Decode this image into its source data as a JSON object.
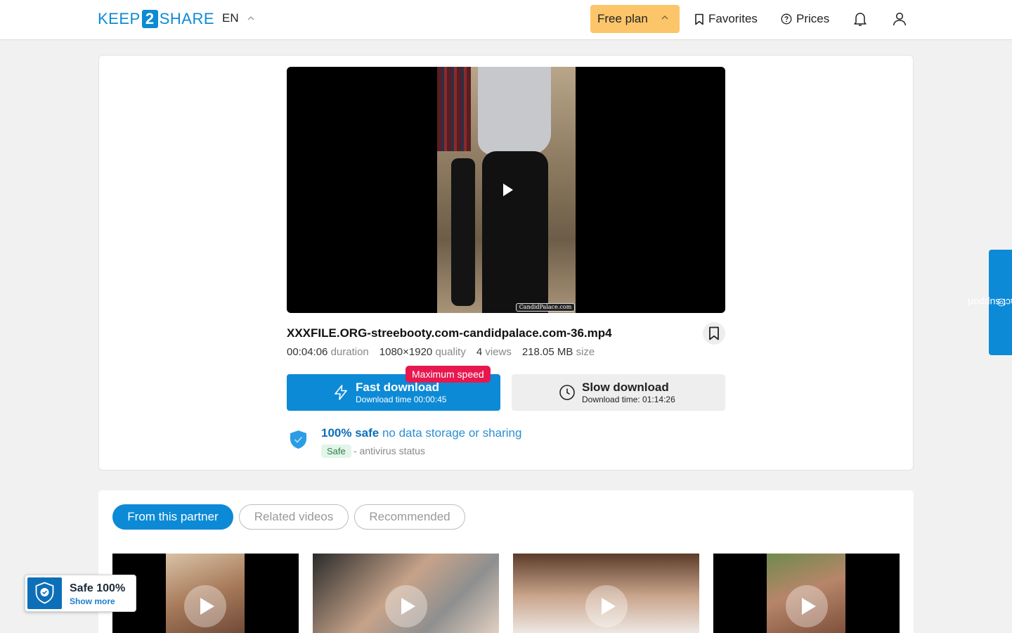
{
  "header": {
    "logo_left": "KEEP",
    "logo_mid": "2",
    "logo_right": "SHARE",
    "language": "EN",
    "plan_label": "Free plan",
    "favorites_label": "Favorites",
    "prices_label": "Prices"
  },
  "file": {
    "name": "XXXFILE.ORG-streebooty.com-candidpalace.com-36.mp4",
    "watermark": "CandidPalace.com",
    "duration_value": "00:04:06",
    "duration_label": "duration",
    "quality_value": "1080×1920",
    "quality_label": "quality",
    "views_value": "4",
    "views_label": "views",
    "size_value": "218.05 MB",
    "size_label": "size"
  },
  "download": {
    "fast_title": "Fast download",
    "fast_sub": "Download time 00:00:45",
    "max_badge": "Maximum speed",
    "slow_title": "Slow download",
    "slow_sub": "Download time: 01:14:26"
  },
  "safety": {
    "safe_bold": "100% safe",
    "safe_note": "no data storage or sharing",
    "chip": "Safe",
    "antivirus": "- antivirus status"
  },
  "tabs": [
    {
      "label": "From this partner",
      "active": true
    },
    {
      "label": "Related videos",
      "active": false
    },
    {
      "label": "Recommended",
      "active": false
    }
  ],
  "support_label": "contact support",
  "safe_widget": {
    "title": "Safe 100%",
    "link": "Show more"
  },
  "colors": {
    "accent": "#0d8ad6",
    "plan": "#fcc56a",
    "badge": "#e7184e"
  }
}
